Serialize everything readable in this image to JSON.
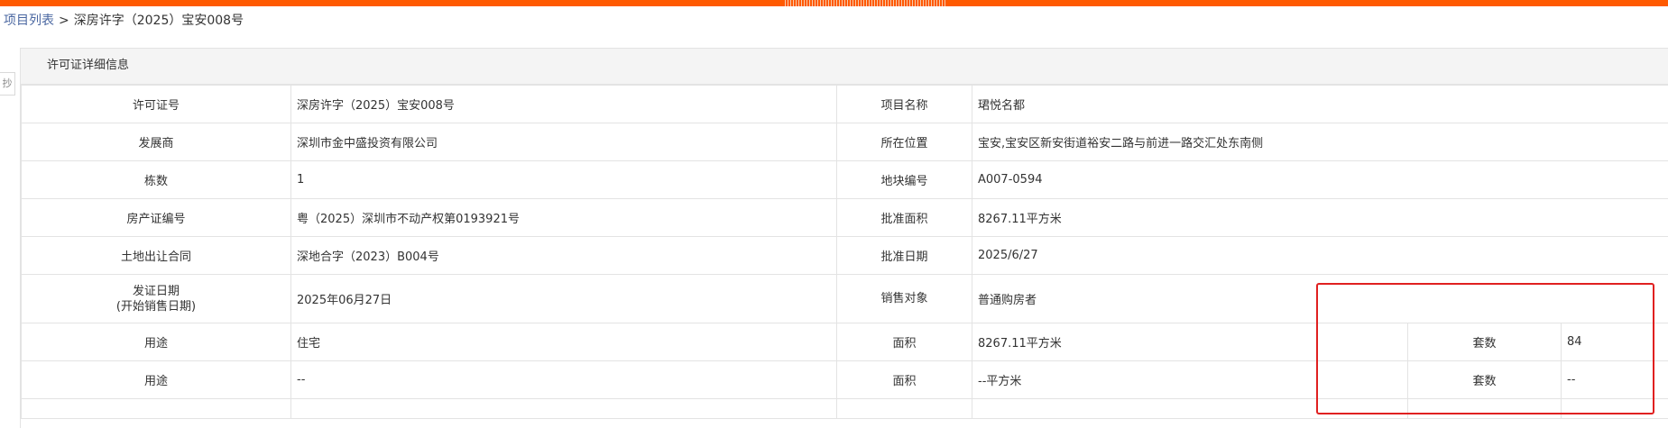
{
  "breadcrumb": {
    "root": "项目列表",
    "separator": ">",
    "current": "深房许字（2025）宝安008号"
  },
  "side_tab": {
    "label": "抄"
  },
  "panel": {
    "title": "许可证详细信息"
  },
  "details": {
    "license_no_label": "许可证号",
    "license_no": "深房许字（2025）宝安008号",
    "project_name_label": "项目名称",
    "project_name": "珺悦名都",
    "developer_label": "发展商",
    "developer": "深圳市金中盛投资有限公司",
    "location_label": "所在位置",
    "location": "宝安,宝安区新安街道裕安二路与前进一路交汇处东南侧",
    "buildings_label": "栋数",
    "buildings": "1",
    "parcel_no_label": "地块编号",
    "parcel_no": "A007-0594",
    "property_cert_label": "房产证编号",
    "property_cert": "粤（2025）深圳市不动产权第0193921号",
    "approved_area_label": "批准面积",
    "approved_area": "8267.11平方米",
    "land_contract_label": "土地出让合同",
    "land_contract": "深地合字（2023）B004号",
    "approval_date_label": "批准日期",
    "approval_date": "2025/6/27",
    "issue_date_label_line1": "发证日期",
    "issue_date_label_line2": "(开始销售日期)",
    "issue_date": "2025年06月27日",
    "sales_target_label": "销售对象",
    "sales_target": "普通购房者"
  },
  "usage_rows": [
    {
      "usage_label": "用途",
      "usage": "住宅",
      "area_label": "面积",
      "area": "8267.11平方米",
      "units_label": "套数",
      "units": "84"
    },
    {
      "usage_label": "用途",
      "usage": "--",
      "area_label": "面积",
      "area": "--平方米",
      "units_label": "套数",
      "units": "--"
    }
  ],
  "colors": {
    "top_bar": "#ff5a00",
    "highlight_box": "#e02020",
    "header_bg": "#f4f4f4",
    "border": "#e3e3e3",
    "link": "#4a67a1"
  }
}
